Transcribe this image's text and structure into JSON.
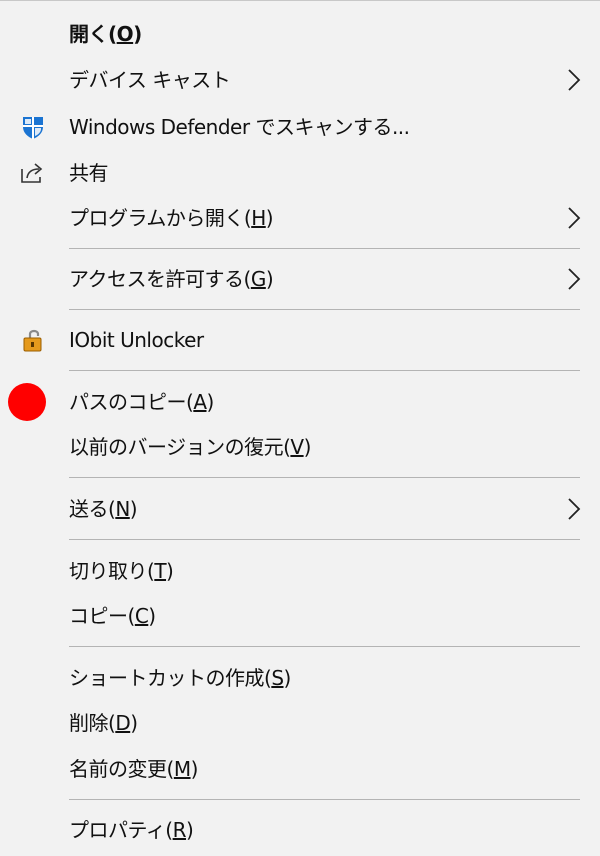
{
  "menu": {
    "items": [
      {
        "label": "開く(",
        "key": "O",
        "tail": ")"
      },
      {
        "label": "デバイス キャスト",
        "key": "",
        "tail": ""
      },
      {
        "label": "Windows Defender でスキャンする...",
        "key": "",
        "tail": ""
      },
      {
        "label": "共有",
        "key": "",
        "tail": ""
      },
      {
        "label": "プログラムから開く(",
        "key": "H",
        "tail": ")"
      },
      {
        "label": "アクセスを許可する(",
        "key": "G",
        "tail": ")"
      },
      {
        "label": "IObit Unlocker",
        "key": "",
        "tail": ""
      },
      {
        "label": "パスのコピー(",
        "key": "A",
        "tail": ")"
      },
      {
        "label": "以前のバージョンの復元(",
        "key": "V",
        "tail": ")"
      },
      {
        "label": "送る(",
        "key": "N",
        "tail": ")"
      },
      {
        "label": "切り取り(",
        "key": "T",
        "tail": ")"
      },
      {
        "label": "コピー(",
        "key": "C",
        "tail": ")"
      },
      {
        "label": "ショートカットの作成(",
        "key": "S",
        "tail": ")"
      },
      {
        "label": "削除(",
        "key": "D",
        "tail": ")"
      },
      {
        "label": "名前の変更(",
        "key": "M",
        "tail": ")"
      },
      {
        "label": "プロパティ(",
        "key": "R",
        "tail": ")"
      }
    ]
  },
  "colors": {
    "background": "#f2f2f2",
    "separator": "#b4b4b4",
    "text": "#111111",
    "defender_blue": "#1b74d2",
    "lock_orange": "#e59a1d",
    "marker_red": "#ff0000"
  },
  "icons": {
    "defender": "windows-defender-shield-icon",
    "share": "share-icon",
    "unlocker": "iobit-unlocker-lock-icon",
    "marker": "red-dot-marker",
    "submenu": "chevron-right-icon"
  }
}
